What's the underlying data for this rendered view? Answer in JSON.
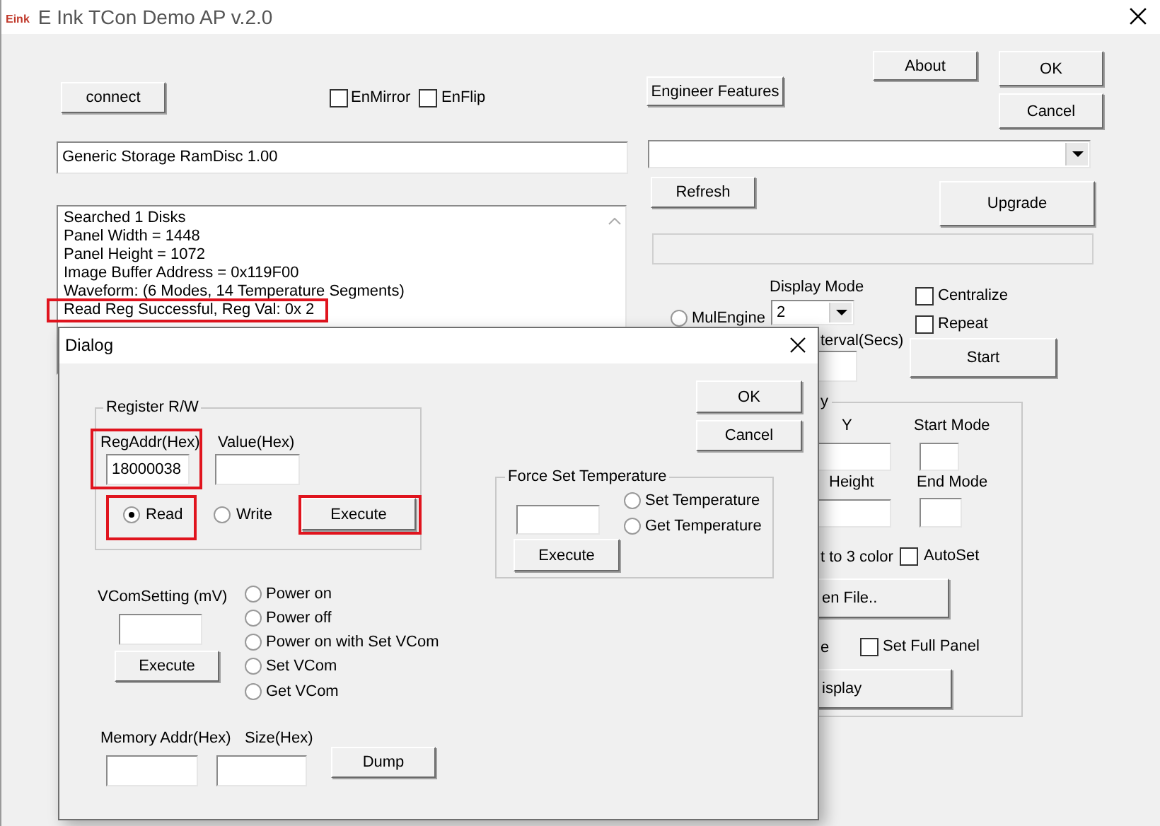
{
  "window": {
    "logo": "Eink",
    "title": "E Ink TCon Demo AP v.2.0"
  },
  "main": {
    "connect_button": "connect",
    "checkboxes": [
      {
        "label": "EnMirror",
        "checked": false
      },
      {
        "label": "EnFlip",
        "checked": false
      }
    ],
    "engineer_button": "Engineer Features",
    "about_button": "About",
    "ok_button": "OK",
    "cancel_button": "Cancel",
    "device_field": "Generic Storage RamDisc 1.00",
    "refresh_button": "Refresh",
    "upgrade_button": "Upgrade",
    "log": [
      {
        "text": "Searched 1 Disks",
        "highlighted": false
      },
      {
        "text": "Panel Width = 1448",
        "highlighted": false
      },
      {
        "text": "Panel Height = 1072",
        "highlighted": false
      },
      {
        "text": "Image Buffer Address = 0x119F00",
        "highlighted": false
      },
      {
        "text": "Waveform: (6 Modes, 14 Temperature Segments)",
        "highlighted": false
      },
      {
        "text": "Read Reg Successful, Reg Val: 0x 2",
        "highlighted": true
      }
    ],
    "mulengine": {
      "label": "MulEngine",
      "selected": false
    },
    "display_mode": {
      "label": "Display Mode",
      "value": "2"
    },
    "interval_label": "terval(Secs)",
    "options": [
      {
        "label": "Centralize",
        "checked": false
      },
      {
        "label": "Repeat",
        "checked": false
      }
    ],
    "start_button": "Start",
    "group": {
      "title": "y",
      "y_label": "Y",
      "start_mode_label": "Start Mode",
      "height_label": "Height",
      "end_mode_label": "End Mode",
      "color_label": "t to 3 color",
      "autoset": {
        "label": "AutoSet",
        "checked": false
      },
      "open_file_button": "en File..",
      "label_e": "e",
      "full_panel": {
        "label": "Set Full Panel",
        "checked": false
      },
      "display_button": "isplay"
    }
  },
  "dialog": {
    "title": "Dialog",
    "ok_button": "OK",
    "cancel_button": "Cancel",
    "register": {
      "title": "Register R/W",
      "reg_addr": {
        "label": "RegAddr(Hex)",
        "value": "18000038",
        "highlighted": true
      },
      "value_label": "Value(Hex)",
      "modes": [
        {
          "label": "Read",
          "selected": true,
          "highlighted": true
        },
        {
          "label": "Write",
          "selected": false,
          "highlighted": false
        }
      ],
      "execute": {
        "label": "Execute",
        "highlighted": true
      }
    },
    "temperature": {
      "title": "Force Set Temperature",
      "modes": [
        {
          "label": "Set Temperature",
          "selected": false
        },
        {
          "label": "Get Temperature",
          "selected": false
        }
      ],
      "execute_button": "Execute"
    },
    "vcom": {
      "label": "VComSetting (mV)",
      "execute_button": "Execute",
      "modes": [
        {
          "label": "Power on",
          "selected": false
        },
        {
          "label": "Power off",
          "selected": false
        },
        {
          "label": "Power on with Set VCom",
          "selected": false
        },
        {
          "label": "Set VCom",
          "selected": false
        },
        {
          "label": "Get VCom",
          "selected": false
        }
      ]
    },
    "memory": {
      "addr_label": "Memory Addr(Hex)",
      "size_label": "Size(Hex)",
      "dump_button": "Dump"
    }
  }
}
